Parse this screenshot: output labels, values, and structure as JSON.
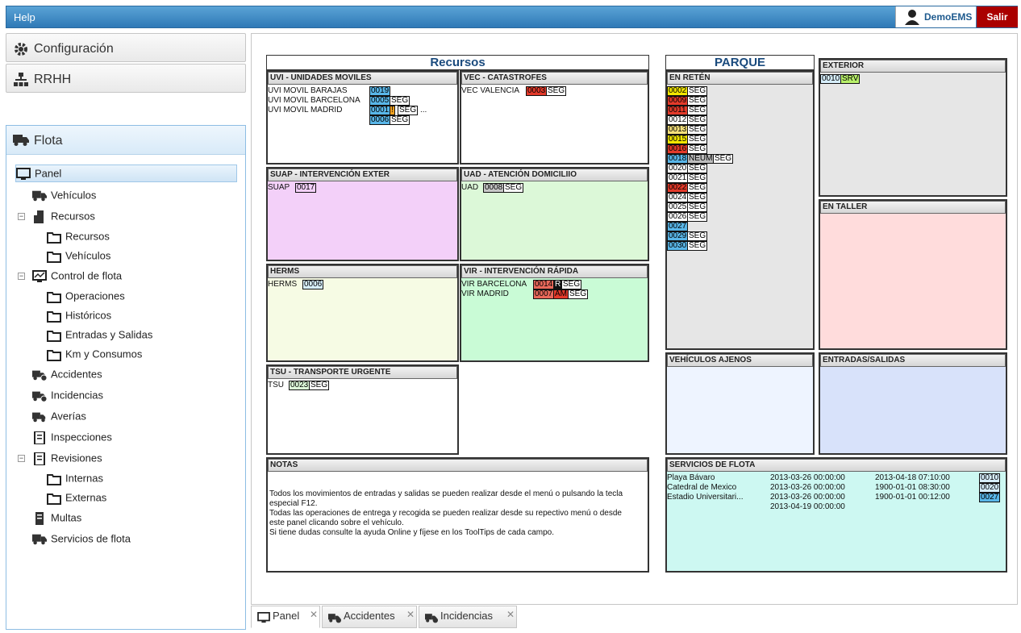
{
  "topbar": {
    "help": "Help",
    "user": "DemoEMS",
    "logout": "Salir"
  },
  "sidebar": {
    "config": "Configuración",
    "rrhh": "RRHH",
    "flota": "Flota",
    "items": [
      "Panel",
      "Vehículos",
      "Recursos",
      "Recursos",
      "Vehículos",
      "Control de flota",
      "Operaciones",
      "Históricos",
      "Entradas y Salidas",
      "Km y Consumos",
      "Accidentes",
      "Incidencias",
      "Averías",
      "Inspecciones",
      "Revisiones",
      "Internas",
      "Externas",
      "Multas",
      "Servicios de flota"
    ]
  },
  "tabs": [
    "Panel",
    "Accidentes",
    "Incidencias"
  ],
  "recursos": {
    "title": "Recursos",
    "uvi": {
      "title": "UVI - UNIDADES MOVILES",
      "rows": [
        "UVI MOVIL BARAJAS",
        "UVI MOVIL BARCELONA",
        "UVI MOVIL MADRID"
      ],
      "chips": [
        "0019",
        "0005",
        "SEG",
        "0001",
        "!",
        "SEG",
        "...",
        "0006",
        "SEG"
      ]
    },
    "vec": {
      "title": "VEC - CATASTROFES",
      "rows": [
        "VEC VALENCIA"
      ],
      "chips": [
        "0003",
        "SEG"
      ]
    },
    "suap": {
      "title": "SUAP - INTERVENCIÓN EXTER",
      "rows": [
        "SUAP"
      ],
      "chips": [
        "0017"
      ]
    },
    "uad": {
      "title": "UAD - ATENCIÓN DOMICILIIO",
      "rows": [
        "UAD"
      ],
      "chips": [
        "0008",
        "SEG"
      ]
    },
    "herms": {
      "title": "HERMS",
      "rows": [
        "HERMS"
      ],
      "chips": [
        "0006"
      ]
    },
    "vir": {
      "title": "VIR - INTERVENCIÓN RÁPIDA",
      "rows": [
        "VIR BARCELONA",
        "VIR MADRID"
      ],
      "chips": [
        "0014",
        "R",
        "SEG",
        "0007",
        "AM",
        "SEG"
      ]
    },
    "tsu": {
      "title": "TSU - TRANSPORTE URGENTE",
      "rows": [
        "TSU"
      ],
      "chips": [
        "0023",
        "SEG"
      ]
    },
    "notas": {
      "title": "NOTAS",
      "lines": [
        "Todos los movimientos de entradas y salidas se pueden realizar desde el menú o pulsando la tecla",
        "especial F12.",
        "Todas las operaciones de entrega y recogida se pueden realizar desde su repectivo menú o desde",
        "este panel clicando sobre el vehículo.",
        "Si tiene dudas consulte la ayuda Online y fíjese en los ToolTips de cada campo."
      ]
    }
  },
  "parque": {
    "title": "PARQUE",
    "reten": {
      "title": "EN RETÉN",
      "units": [
        {
          "id": "0002",
          "color": "#f2e600",
          "tags": [
            "SEG"
          ]
        },
        {
          "id": "0009",
          "color": "#e33a2a",
          "tags": [
            "SEG"
          ]
        },
        {
          "id": "0011",
          "color": "#e33a2a",
          "tags": [
            "SEG"
          ]
        },
        {
          "id": "0012",
          "color": "#ffffff",
          "tags": [
            "SEG"
          ]
        },
        {
          "id": "0013",
          "color": "#f5e07a",
          "tags": [
            "SEG"
          ]
        },
        {
          "id": "0015",
          "color": "#f2e600",
          "tags": [
            "SEG"
          ]
        },
        {
          "id": "0016",
          "color": "#e33a2a",
          "tags": [
            "SEG"
          ]
        },
        {
          "id": "0018",
          "color": "#59b6e8",
          "tags": [
            "NEUM",
            "SEG"
          ]
        },
        {
          "id": "0020",
          "color": "#ffffff",
          "tags": [
            "SEG"
          ]
        },
        {
          "id": "0021",
          "color": "#ffffff",
          "tags": [
            "SEG"
          ]
        },
        {
          "id": "0022",
          "color": "#e33a2a",
          "tags": [
            "SEG"
          ]
        },
        {
          "id": "0024",
          "color": "#ffffff",
          "tags": [
            "SEG"
          ]
        },
        {
          "id": "0025",
          "color": "#ffffff",
          "tags": [
            "SEG"
          ]
        },
        {
          "id": "0026",
          "color": "#ffffff",
          "tags": [
            "SEG"
          ]
        },
        {
          "id": "0027",
          "color": "#59b6e8",
          "tags": []
        },
        {
          "id": "0029",
          "color": "#59b6e8",
          "tags": [
            "SEG"
          ]
        },
        {
          "id": "0030",
          "color": "#59b6e8",
          "tags": [
            "SEG"
          ]
        }
      ]
    },
    "exterior": {
      "title": "EXTERIOR",
      "chips": [
        "0010",
        "SRV"
      ]
    },
    "taller": {
      "title": "EN TALLER"
    },
    "ajenos": {
      "title": "VEHÍCULOS AJENOS"
    },
    "entradas": {
      "title": "ENTRADAS/SALIDAS"
    },
    "servicios": {
      "title": "SERVICIOS DE FLOTA",
      "rows": [
        {
          "name": "Playa Bávaro",
          "start": "2013-03-26 00:00:00",
          "end": "2013-04-18 07:10:00",
          "unit": "0010"
        },
        {
          "name": "Catedral de Mexico",
          "start": "2013-03-26 00:00:00",
          "end": "1900-01-01 08:30:00",
          "unit": "0020"
        },
        {
          "name": "Estadio Universitari...",
          "start": "2013-03-26 00:00:00",
          "end": "1900-01-01 00:12:00",
          "unit": "0027"
        },
        {
          "name": "",
          "start": "2013-04-19 00:00:00",
          "end": "",
          "unit": ""
        }
      ]
    }
  }
}
